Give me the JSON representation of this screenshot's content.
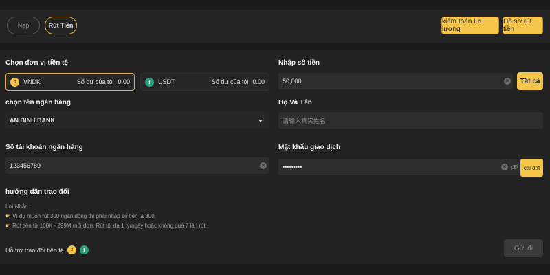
{
  "tabs": {
    "deposit": "Nạp",
    "withdraw": "Rút Tiền"
  },
  "actions": {
    "audit": "kiểm toán lưu lượng",
    "history": "Hồ sơ rút tiền"
  },
  "currency": {
    "label": "Chọn đơn vị tiền tệ",
    "balance_label": "Số dư của tôi",
    "options": [
      {
        "name": "VNDK",
        "balance": "0.00",
        "icon": "vndk-coin-icon",
        "selected": true
      },
      {
        "name": "USDT",
        "balance": "0.00",
        "icon": "tether-icon",
        "selected": false
      }
    ]
  },
  "amount": {
    "label": "Nhập số tiền",
    "value": "50,000",
    "all_button": "Tất cả"
  },
  "bank": {
    "label": "chọn tên ngân hàng",
    "value": "AN BINH BANK"
  },
  "full_name": {
    "label": "Họ Và Tên",
    "placeholder": "请输入真实姓名"
  },
  "account": {
    "label": "Số tài khoản ngân hàng",
    "value": "123456789"
  },
  "password": {
    "label": "Mật khẩu giao dịch",
    "value": "•••••••••",
    "set_button": "cài đặt"
  },
  "guide": {
    "title": "hướng dẫn trao đổi",
    "reminder": "Lời Nhắc :",
    "lines": [
      "Ví dụ muốn rút 300 ngàn đồng thì phải nhập số tiền là 300.",
      "Rút tiền từ 100K - 299M mỗi đơn. Rút tối đa 1 tỷ/ngày hoặc không quá 7 lần rút."
    ]
  },
  "support": {
    "label": "Hỗ trợ trao đổi tiền tệ"
  },
  "submit": "Gửi đi",
  "colors": {
    "accent": "#f6c64a",
    "border_accent": "#e3b23c",
    "tether": "#26a17b",
    "panel": "#222222",
    "field": "#2d2d2d"
  }
}
